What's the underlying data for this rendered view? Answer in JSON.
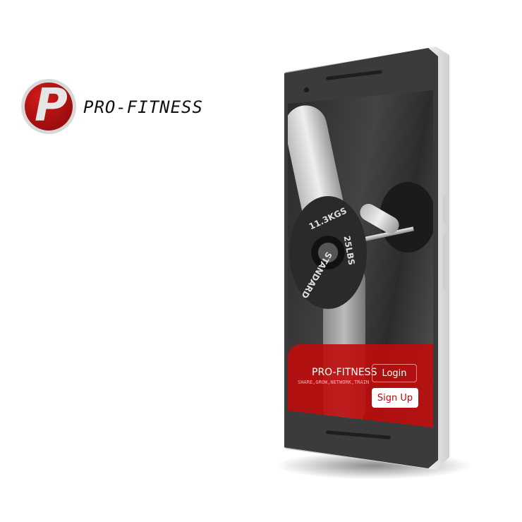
{
  "logo": {
    "letter": "P",
    "brand_name": "PRO-FITNESS",
    "color": "#b30f0f"
  },
  "phone": {
    "photo": {
      "plate_text_1": "11.3KGS",
      "plate_text_2": "25LBS",
      "plate_text_3": "STANDARD"
    },
    "app": {
      "title": "PRO-FITNESS",
      "tagline": "SHARE,GROW,NETWORK,TRAIN",
      "login_label": "Login",
      "signup_label": "Sign Up",
      "accent": "#c00d0d"
    }
  }
}
